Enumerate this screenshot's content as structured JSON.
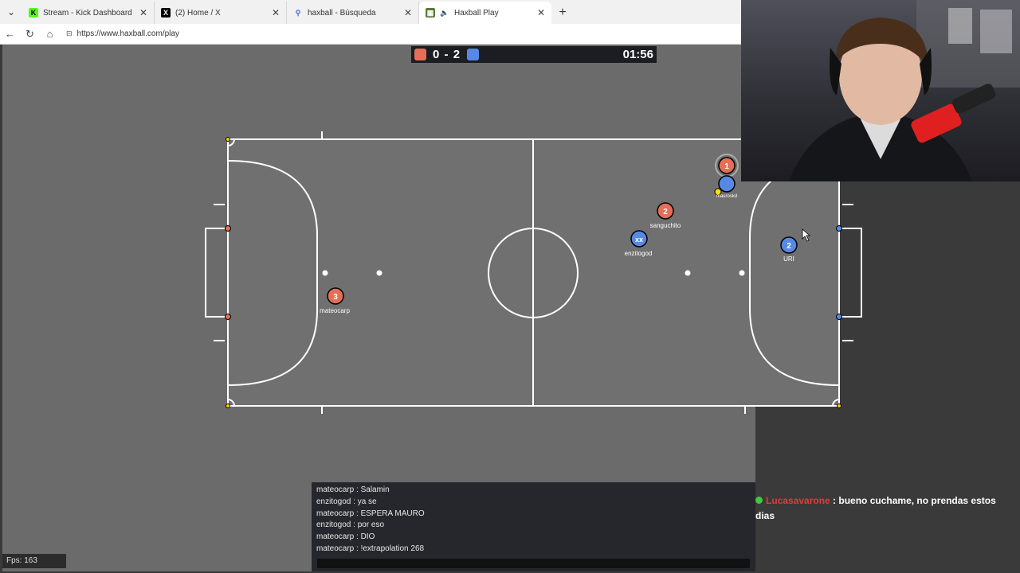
{
  "browser": {
    "tabs": [
      {
        "title": "Stream - Kick Dashboard",
        "icon": "kick-icon",
        "fav": "K",
        "fav_color": "#53fc18",
        "active": false
      },
      {
        "title": "(2) Home / X",
        "icon": "x-icon",
        "fav": "X",
        "fav_color": "#000000",
        "active": false
      },
      {
        "title": "haxball - Búsqueda",
        "icon": "search-icon",
        "fav": "🔍",
        "fav_color": "#ffffff",
        "active": false
      },
      {
        "title": "Haxball Play",
        "icon": "haxball-icon",
        "fav": "⚽",
        "fav_color": "#ffffff",
        "active": true
      }
    ],
    "url": "https://www.haxball.com/play"
  },
  "scoreboard": {
    "red_score": "0",
    "dash": "-",
    "blue_score": "2",
    "time": "01:56",
    "red_color": "#e56e56",
    "blue_color": "#5689e5"
  },
  "players": [
    {
      "num": "1",
      "name": "",
      "team": "red"
    },
    {
      "num": "",
      "name": "mauroskd",
      "team": "blue"
    },
    {
      "num": "2",
      "name": "sanguchito",
      "team": "red"
    },
    {
      "num": "xx",
      "name": "enzitogod",
      "team": "blue"
    },
    {
      "num": "2",
      "name": "URI",
      "team": "blue"
    },
    {
      "num": "3",
      "name": "mateocarp",
      "team": "red"
    }
  ],
  "chat": [
    "mateocarp : Salamin",
    "enzitogod : ya se",
    "mateocarp : ESPERA MAURO",
    "enzitogod : por eso",
    "mateocarp : DIO",
    "mateocarp : !extrapolation 268"
  ],
  "fps": "Fps: 163",
  "stream_chat": {
    "user": "Lucasavarone",
    "sep": " : ",
    "message": "bueno cuchame, no prendas estos dias"
  }
}
